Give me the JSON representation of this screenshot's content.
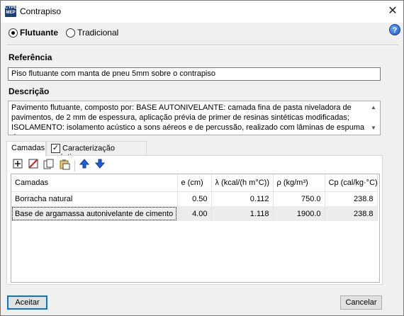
{
  "window": {
    "title": "Contrapiso",
    "app_icon_text": "CYPE MEP"
  },
  "mode": {
    "options": [
      {
        "label": "Flutuante",
        "selected": true
      },
      {
        "label": "Tradicional",
        "selected": false
      }
    ]
  },
  "referencia": {
    "label": "Referência",
    "value": "Piso flutuante com manta de pneu 5mm sobre o contrapiso"
  },
  "descricao": {
    "label": "Descrição",
    "value": "Pavimento flutuante, composto por: BASE AUTONIVELANTE: camada fina de pasta niveladora de pavimentos, de 2 mm de espessura, aplicação prévia de primer de resinas sintéticas modificadas; ISOLAMENTO: isolamento acústico a sons aéreos e de percussão, realizado com lâminas de espuma de"
  },
  "tabs": [
    {
      "label": "Camadas",
      "active": true
    },
    {
      "label": "Caracterização acústica",
      "checked": true
    }
  ],
  "toolbar": {
    "icons": [
      "add-layer-icon",
      "delete-layer-icon",
      "copy-icon",
      "paste-icon",
      "move-up-icon",
      "move-down-icon"
    ]
  },
  "table": {
    "columns": [
      "Camadas",
      "e (cm)",
      "λ (kcal/(h m°C))",
      "ρ (kg/m³)",
      "Cp (cal/kg·°C)"
    ],
    "rows": [
      {
        "cells": [
          "Borracha natural",
          "0.50",
          "0.112",
          "750.0",
          "238.8"
        ],
        "selected": false
      },
      {
        "cells": [
          "Base de argamassa autonivelante de cimento",
          "4.00",
          "1.118",
          "1900.0",
          "238.8"
        ],
        "selected": true
      }
    ]
  },
  "buttons": {
    "ok": "Aceitar",
    "cancel": "Cancelar"
  },
  "colors": {
    "accent": "#0078d7",
    "arrow_blue": "#1f5fd6"
  }
}
